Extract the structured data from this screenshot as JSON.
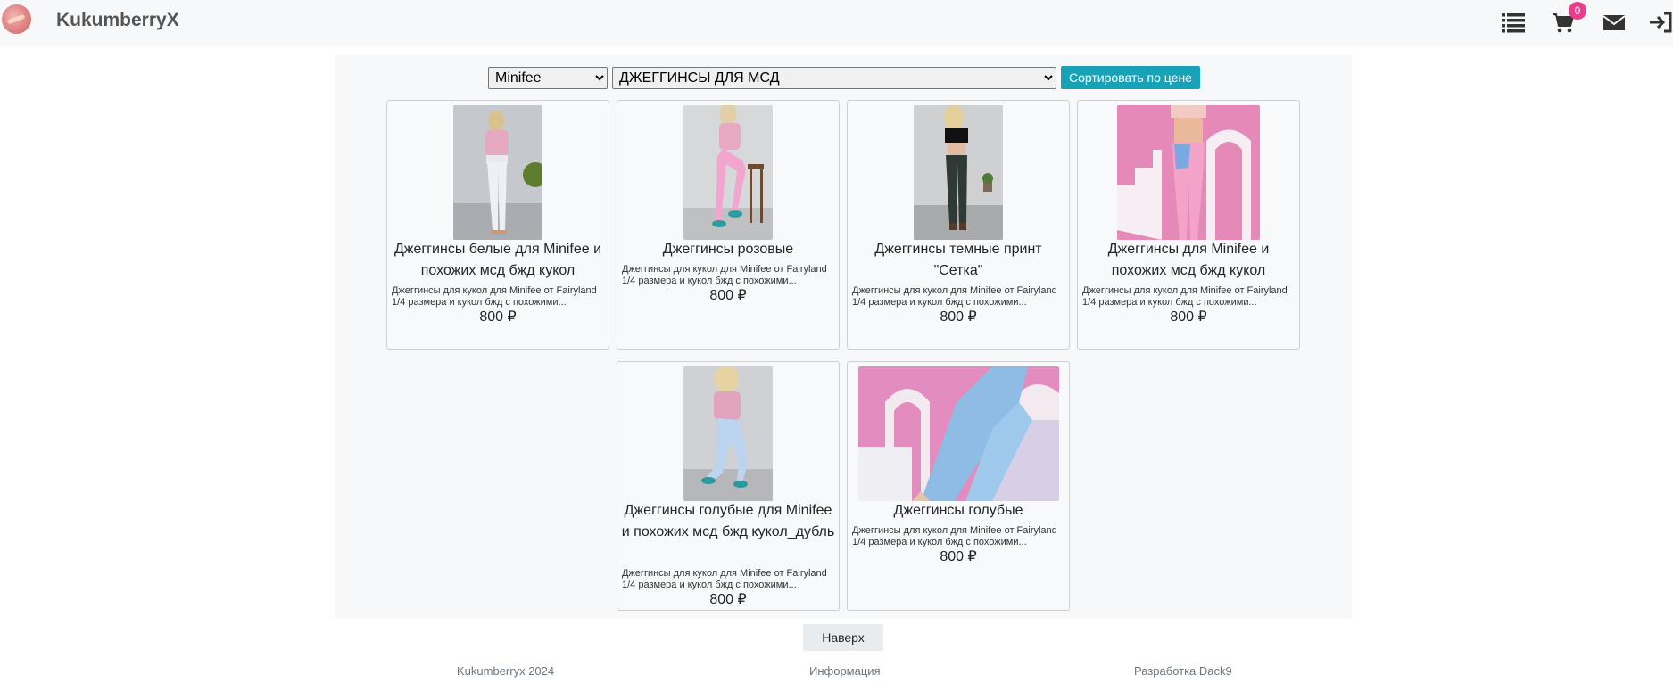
{
  "header": {
    "brand": "KukumberryX",
    "cart_count": "0",
    "icons": [
      "list-icon",
      "cart-icon",
      "mail-icon",
      "sign-in-icon"
    ]
  },
  "filters": {
    "brand_selected": "Minifee",
    "category_selected": "ДЖЕГГИНСЫ ДЛЯ МСД",
    "sort_label": "Сортировать по цене"
  },
  "products": [
    {
      "title": "Джеггинсы белые для Minifee и похожих мсд бжд кукол",
      "desc": "Джеггинсы для кукол для Minifee от Fairyland 1/4 размера и кукол бжд с похожими...",
      "price": "800 ₽"
    },
    {
      "title": "Джеггинсы розовые",
      "desc": "Джеггинсы для кукол для Minifee от Fairyland 1/4 размера и кукол бжд с похожими...",
      "price": "800 ₽"
    },
    {
      "title": "Джеггинсы темные принт \"Сетка\"",
      "desc": "Джеггинсы для кукол для Minifee от Fairyland 1/4 размера и кукол бжд с похожими...",
      "price": "800 ₽"
    },
    {
      "title": "Джеггинсы для Minifee и похожих мсд бжд кукол",
      "desc": "Джеггинсы для кукол для Minifee от Fairyland 1/4 размера и кукол бжд с похожими...",
      "price": "800 ₽"
    },
    {
      "title": "Джеггинсы голубые для Minifee и похожих мсд бжд кукол_дубль",
      "desc": "Джеггинсы для кукол для Minifee от Fairyland 1/4 размера и кукол бжд с похожими...",
      "price": "800 ₽"
    },
    {
      "title": "Джеггинсы голубые",
      "desc": "Джеггинсы для кукол для Minifee от Fairyland 1/4 размера и кукол бжд с похожими...",
      "price": "800 ₽"
    }
  ],
  "back_to_top": "Наверх",
  "footer": {
    "copyright": "Kukumberryx 2024",
    "info": "Информация",
    "dev": "Разработка Dack9"
  },
  "colors": {
    "sort_button": "#17a2b8",
    "badge": "#e83e8c"
  }
}
